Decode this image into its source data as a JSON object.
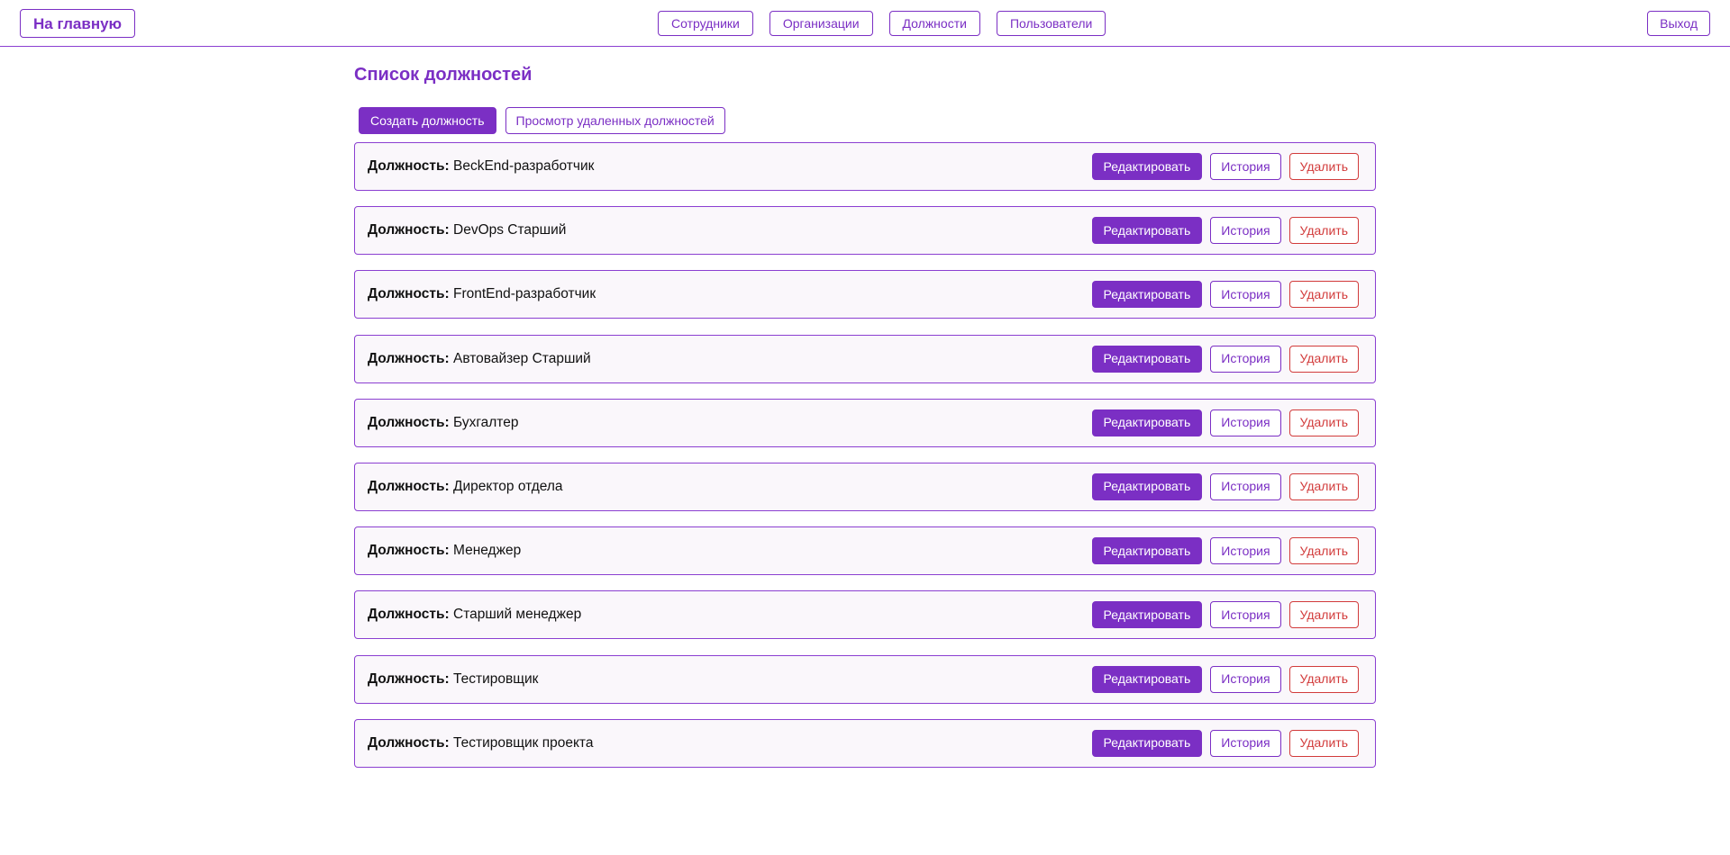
{
  "header": {
    "home_label": "На главную",
    "nav": [
      {
        "label": "Сотрудники"
      },
      {
        "label": "Организации"
      },
      {
        "label": "Должности"
      },
      {
        "label": "Пользователи"
      }
    ],
    "logout_label": "Выход"
  },
  "main": {
    "title": "Список должностей",
    "create_label": "Создать должность",
    "view_deleted_label": "Просмотр удаленных должностей"
  },
  "row_prefix": "Должность:",
  "row_actions": {
    "edit": "Редактировать",
    "history": "История",
    "delete": "Удалить"
  },
  "positions": [
    {
      "name": "BeckEnd-разработчик"
    },
    {
      "name": "DevOps Старший"
    },
    {
      "name": "FrontEnd-разработчик"
    },
    {
      "name": "Автовайзер Старший"
    },
    {
      "name": "Бухгалтер"
    },
    {
      "name": "Директор отдела"
    },
    {
      "name": "Менеджер"
    },
    {
      "name": "Старший менеджер"
    },
    {
      "name": "Тестировщик"
    },
    {
      "name": "Тестировщик проекта"
    }
  ],
  "colors": {
    "accent": "#7b2fc4",
    "danger": "#d23b3b",
    "row_bg": "#faf7fb"
  }
}
